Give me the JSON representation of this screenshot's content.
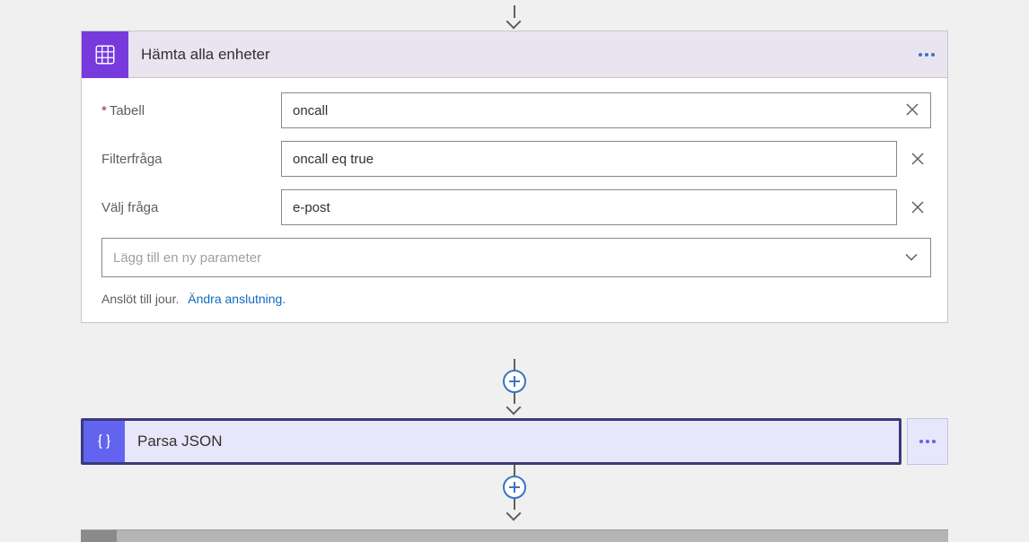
{
  "action1": {
    "title": "Hämta alla enheter",
    "fields": {
      "table": {
        "label": "Tabell",
        "value": "oncall",
        "required": true
      },
      "filter": {
        "label": "Filterfråga",
        "value": "oncall eq true"
      },
      "select": {
        "label": "Välj fråga",
        "value": "e-post"
      }
    },
    "addParam": "Lägg till en ny parameter",
    "connected": "Anslöt till jour.",
    "changeConn": "Ändra anslutning."
  },
  "action2": {
    "title": "Parsa JSON"
  }
}
